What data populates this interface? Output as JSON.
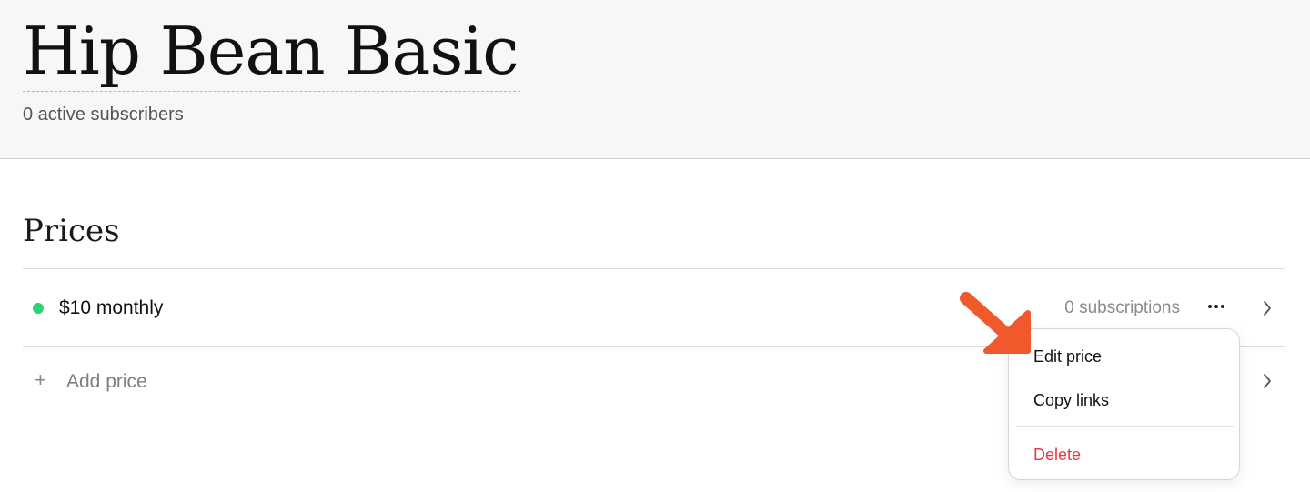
{
  "product": {
    "title": "Hip Bean Basic",
    "subscribers": "0 active subscribers"
  },
  "prices_section": {
    "title": "Prices",
    "items": [
      {
        "label": "$10 monthly",
        "subscriptions": "0 subscriptions",
        "status_color": "#2fd270",
        "more_icon": "more-horizontal-icon",
        "chevron_icon": "chevron-right-icon"
      }
    ],
    "add_label": "Add price",
    "add_icon": "plus-icon"
  },
  "context_menu": {
    "items": [
      {
        "label": "Edit price"
      },
      {
        "label": "Copy links"
      }
    ],
    "delete_label": "Delete",
    "danger_color": "#e53b3b"
  },
  "annotation": {
    "arrow_color": "#f0592b",
    "arrow_icon": "pointer-arrow-icon"
  }
}
